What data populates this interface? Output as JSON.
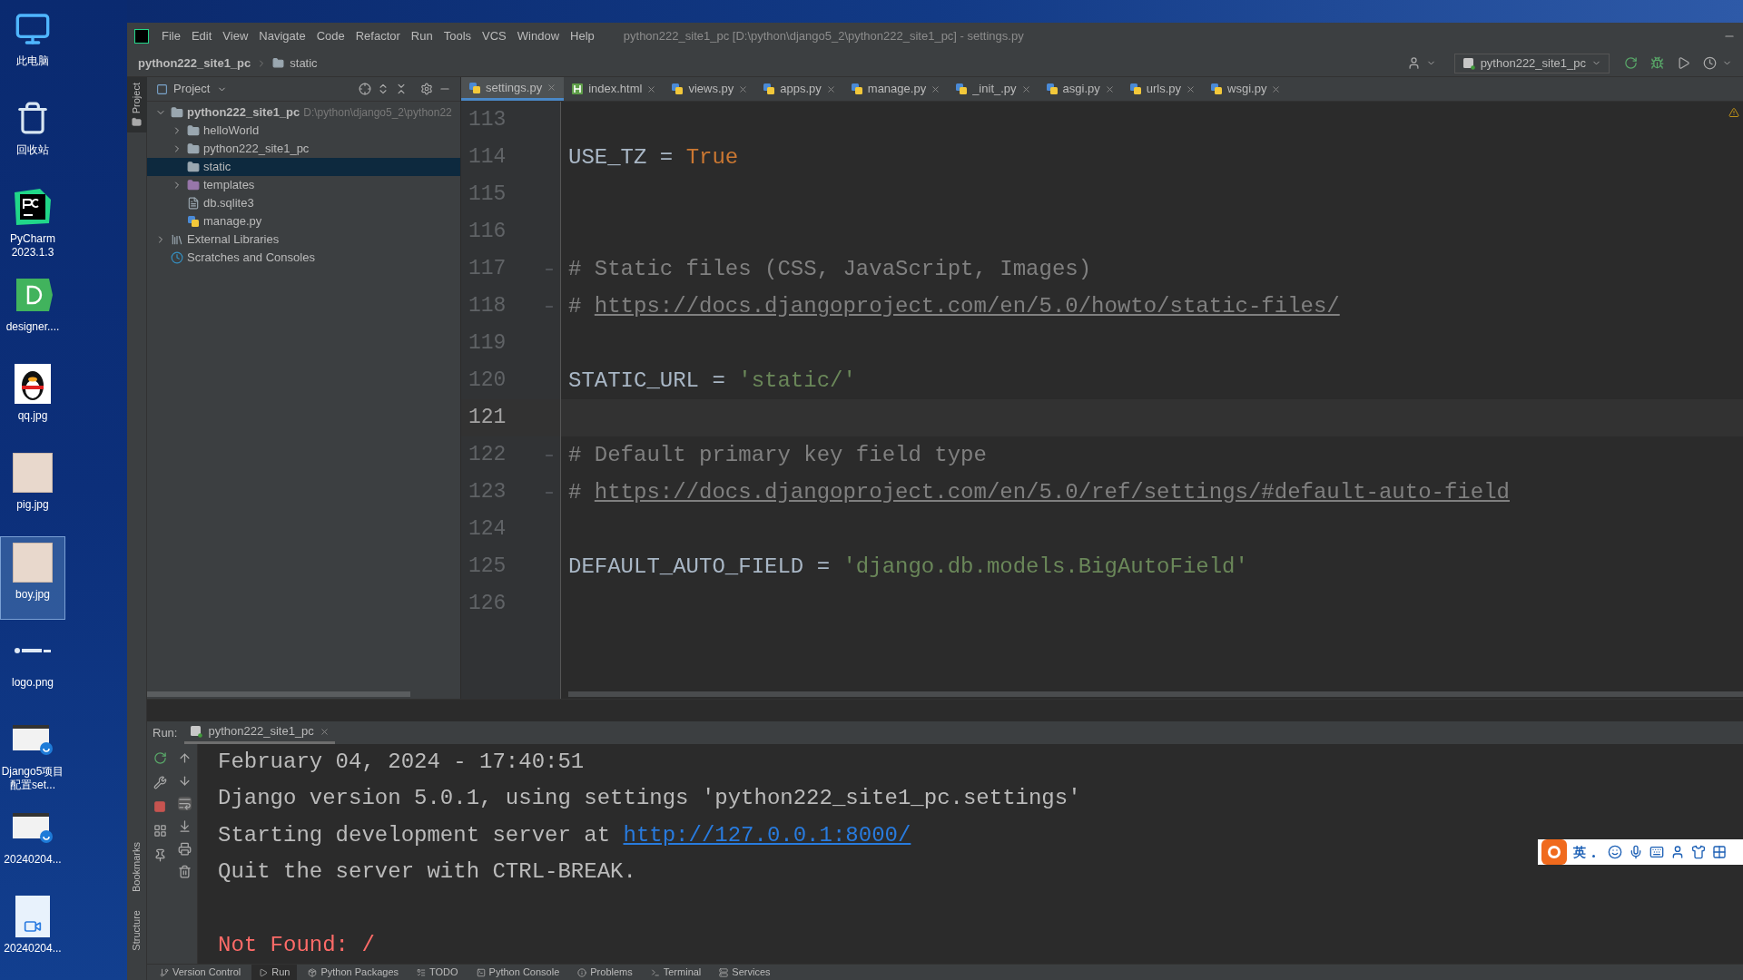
{
  "desktop": {
    "icons": [
      {
        "kind": "computer",
        "label": "此电脑",
        "selected": false
      },
      {
        "kind": "recycle",
        "label": "回收站",
        "selected": false
      },
      {
        "kind": "pycharm",
        "label": "PyCharm 2023.1.3",
        "selected": false
      },
      {
        "kind": "designer",
        "label": "designer....",
        "selected": false
      },
      {
        "kind": "penguin",
        "label": "qq.jpg",
        "selected": false
      },
      {
        "kind": "photo",
        "label": "pig.jpg",
        "selected": false
      },
      {
        "kind": "photo",
        "label": "boy.jpg",
        "selected": true
      },
      {
        "kind": "logo",
        "label": "logo.png",
        "selected": false
      },
      {
        "kind": "video",
        "label": "Django5项目配置set...",
        "selected": false
      },
      {
        "kind": "video",
        "label": "20240204...",
        "selected": false
      },
      {
        "kind": "mp4",
        "label": "20240204...",
        "selected": false
      }
    ]
  },
  "window": {
    "title": "python222_site1_pc [D:\\python\\django5_2\\python222_site1_pc] - settings.py"
  },
  "menu": [
    "File",
    "Edit",
    "View",
    "Navigate",
    "Code",
    "Refactor",
    "Run",
    "Tools",
    "VCS",
    "Window",
    "Help"
  ],
  "breadcrumbs": [
    "python222_site1_pc",
    "static"
  ],
  "run_config": "python222_site1_pc",
  "side_tools": {
    "top": "Project",
    "bottom": [
      "Bookmarks",
      "Structure"
    ]
  },
  "project": {
    "title": "Project",
    "tree": [
      {
        "kind": "module",
        "name": "python222_site1_pc",
        "path": "D:\\python\\django5_2\\python22",
        "expanded": true,
        "selected": false,
        "children": [
          {
            "kind": "package",
            "name": "helloWorld",
            "expanded": false,
            "selected": false
          },
          {
            "kind": "package",
            "name": "python222_site1_pc",
            "expanded": false,
            "selected": false
          },
          {
            "kind": "folder",
            "name": "static",
            "selected": true
          },
          {
            "kind": "templates",
            "name": "templates",
            "expanded": false,
            "selected": false
          },
          {
            "kind": "db",
            "name": "db.sqlite3",
            "selected": false
          },
          {
            "kind": "python",
            "name": "manage.py",
            "selected": false
          }
        ]
      },
      {
        "kind": "libraries",
        "name": "External Libraries",
        "expanded": false,
        "selected": false
      },
      {
        "kind": "scratches",
        "name": "Scratches and Consoles",
        "selected": false
      }
    ]
  },
  "tabs": [
    {
      "label": "settings.py",
      "kind": "python",
      "selected": true
    },
    {
      "label": "index.html",
      "kind": "html",
      "selected": false
    },
    {
      "label": "views.py",
      "kind": "python",
      "selected": false
    },
    {
      "label": "apps.py",
      "kind": "python",
      "selected": false
    },
    {
      "label": "manage.py",
      "kind": "python",
      "selected": false
    },
    {
      "label": "_init_.py",
      "kind": "python",
      "selected": false
    },
    {
      "label": "asgi.py",
      "kind": "python",
      "selected": false
    },
    {
      "label": "urls.py",
      "kind": "python",
      "selected": false
    },
    {
      "label": "wsgi.py",
      "kind": "python",
      "selected": false
    }
  ],
  "code": [
    {
      "number": "113",
      "current": false,
      "fold": false
    },
    {
      "number": "114",
      "current": false,
      "fold": false,
      "tokens": [
        {
          "kind": "ident",
          "text": "USE_TZ = "
        },
        {
          "kind": "keyword",
          "text": "True"
        }
      ]
    },
    {
      "number": "115",
      "current": false,
      "fold": false
    },
    {
      "number": "116",
      "current": false,
      "fold": false
    },
    {
      "number": "117",
      "current": false,
      "fold": true,
      "tokens": [
        {
          "kind": "comment",
          "text": "# Static files (CSS, JavaScript, Images)"
        }
      ]
    },
    {
      "number": "118",
      "current": false,
      "fold": true,
      "tokens": [
        {
          "kind": "comment",
          "text": "# "
        },
        {
          "kind": "link",
          "text": "https://docs.djangoproject.com/en/5.0/howto/static-files/"
        }
      ]
    },
    {
      "number": "119",
      "current": false,
      "fold": false
    },
    {
      "number": "120",
      "current": false,
      "fold": false,
      "tokens": [
        {
          "kind": "ident",
          "text": "STATIC_URL = "
        },
        {
          "kind": "string",
          "text": "'static/'"
        }
      ]
    },
    {
      "number": "121",
      "current": true,
      "fold": false
    },
    {
      "number": "122",
      "current": false,
      "fold": true,
      "tokens": [
        {
          "kind": "comment",
          "text": "# Default primary key field type"
        }
      ]
    },
    {
      "number": "123",
      "current": false,
      "fold": true,
      "tokens": [
        {
          "kind": "comment",
          "text": "# "
        },
        {
          "kind": "link",
          "text": "https://docs.djangoproject.com/en/5.0/ref/settings/#default-auto-field"
        }
      ]
    },
    {
      "number": "124",
      "current": false,
      "fold": false
    },
    {
      "number": "125",
      "current": false,
      "fold": false,
      "tokens": [
        {
          "kind": "ident",
          "text": "DEFAULT_AUTO_FIELD = "
        },
        {
          "kind": "string",
          "text": "'django.db.models.BigAutoField'"
        }
      ]
    },
    {
      "number": "126",
      "current": false,
      "fold": false
    }
  ],
  "run": {
    "label": "Run:",
    "tab": "python222_site1_pc",
    "console": [
      {
        "kind": "text",
        "tokens": [
          {
            "kind": "normal",
            "text": "February 04, 2024 - 17:40:51"
          }
        ]
      },
      {
        "kind": "text",
        "tokens": [
          {
            "kind": "normal",
            "text": "Django version 5.0.1, using settings 'python222_site1_pc.settings'"
          }
        ]
      },
      {
        "kind": "text",
        "tokens": [
          {
            "kind": "normal",
            "text": "Starting development server at "
          },
          {
            "kind": "link",
            "text": "http://127.0.0.1:8000/"
          }
        ]
      },
      {
        "kind": "text",
        "tokens": [
          {
            "kind": "normal",
            "text": "Quit the server with CTRL-BREAK."
          }
        ]
      },
      {
        "kind": "blank"
      },
      {
        "kind": "text",
        "tokens": [
          {
            "kind": "error",
            "text": "Not Found: /"
          }
        ]
      }
    ]
  },
  "tool_windows": [
    {
      "kind": "vcs",
      "label": "Version Control",
      "selected": false
    },
    {
      "kind": "run",
      "label": "Run",
      "selected": true
    },
    {
      "kind": "packages",
      "label": "Python Packages",
      "selected": false
    },
    {
      "kind": "todo",
      "label": "TODO",
      "selected": false
    },
    {
      "kind": "console",
      "label": "Python Console",
      "selected": false
    },
    {
      "kind": "problems",
      "label": "Problems",
      "selected": false
    },
    {
      "kind": "terminal",
      "label": "Terminal",
      "selected": false
    },
    {
      "kind": "services",
      "label": "Services",
      "selected": false
    }
  ],
  "ime": {
    "mode": "英"
  }
}
